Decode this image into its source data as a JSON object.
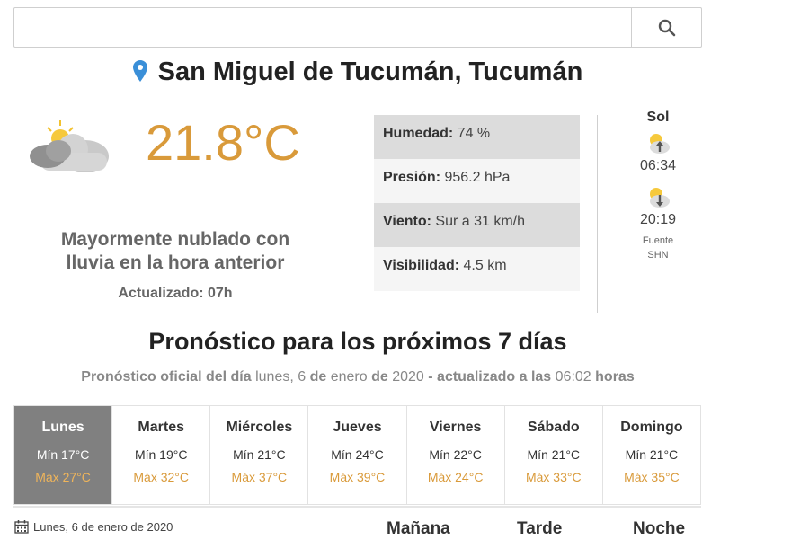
{
  "search": {
    "placeholder": ""
  },
  "location": {
    "name": "San Miguel de Tucumán, Tucumán"
  },
  "current": {
    "temperature": "21.8°C",
    "description": "Mayormente nublado con lluvia en la hora anterior",
    "updated": "Actualizado: 07h",
    "icon": "cloudy-sun-icon"
  },
  "stats": [
    {
      "label": "Humedad:",
      "value": "74 %"
    },
    {
      "label": "Presión:",
      "value": "956.2 hPa"
    },
    {
      "label": "Viento:",
      "value": "Sur a 31 km/h"
    },
    {
      "label": "Visibilidad:",
      "value": "4.5 km"
    }
  ],
  "sun": {
    "title": "Sol",
    "sunrise": "06:34",
    "sunset": "20:19",
    "source_label": "Fuente",
    "source": "SHN"
  },
  "forecast": {
    "title": "Pronóstico para los próximos 7 días",
    "subtitle": {
      "p1": "Pronóstico oficial del día",
      "p2": "lunes, 6",
      "p3": "de",
      "p4": "enero",
      "p5": "de",
      "p6": "2020",
      "p7": "- actualizado a las",
      "p8": "06:02",
      "p9": "horas"
    },
    "days": [
      {
        "name": "Lunes",
        "min": "Mín 17°C",
        "max": "Máx 27°C"
      },
      {
        "name": "Martes",
        "min": "Mín 19°C",
        "max": "Máx 32°C"
      },
      {
        "name": "Miércoles",
        "min": "Mín 21°C",
        "max": "Máx 37°C"
      },
      {
        "name": "Jueves",
        "min": "Mín 24°C",
        "max": "Máx 39°C"
      },
      {
        "name": "Viernes",
        "min": "Mín 22°C",
        "max": "Máx 24°C"
      },
      {
        "name": "Sábado",
        "min": "Mín 21°C",
        "max": "Máx 33°C"
      },
      {
        "name": "Domingo",
        "min": "Mín 21°C",
        "max": "Máx 35°C"
      }
    ],
    "selected_date": "Lunes, 6 de enero de 2020",
    "periods": [
      "Mañana",
      "Tarde",
      "Noche"
    ]
  },
  "colors": {
    "accent": "#d99a3a",
    "active_day": "#808080"
  }
}
